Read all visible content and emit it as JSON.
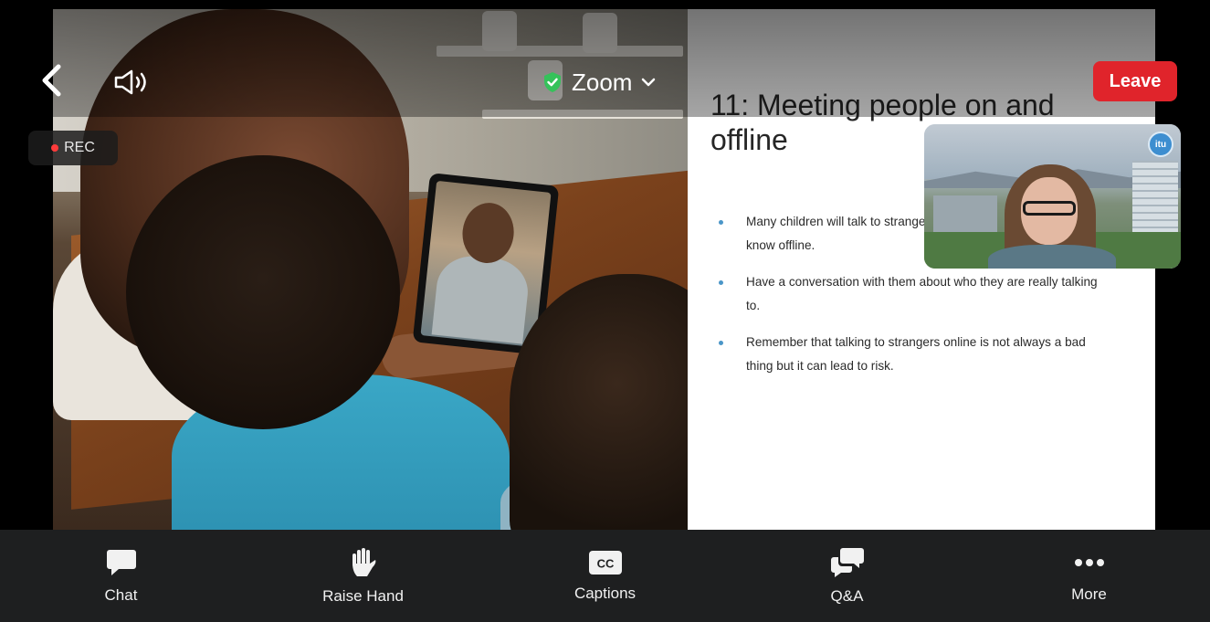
{
  "header": {
    "meeting_name": "Zoom",
    "leave_label": "Leave",
    "rec_label": "REC"
  },
  "slide": {
    "title": "11: Meeting people on and offline",
    "bullets": [
      "Many children will talk to strangers online – people they don't know offline.",
      "Have a conversation with them about who they are really talking to.",
      "Remember that talking to strangers online is not always a bad thing but it can lead to risk."
    ]
  },
  "presenter": {
    "logo_text": "itu"
  },
  "toolbar": {
    "items": [
      {
        "label": "Chat",
        "icon": "chat-icon"
      },
      {
        "label": "Raise Hand",
        "icon": "raise-hand-icon"
      },
      {
        "label": "Captions",
        "icon": "captions-icon"
      },
      {
        "label": "Q&A",
        "icon": "qa-icon"
      },
      {
        "label": "More",
        "icon": "more-icon"
      }
    ],
    "captions_badge": "CC"
  },
  "colors": {
    "leave": "#e0242b",
    "rec_dot": "#ff3b3b",
    "shield": "#35c25a",
    "bullet": "#4a96c8",
    "toolbar_bg": "#1e1f20"
  }
}
